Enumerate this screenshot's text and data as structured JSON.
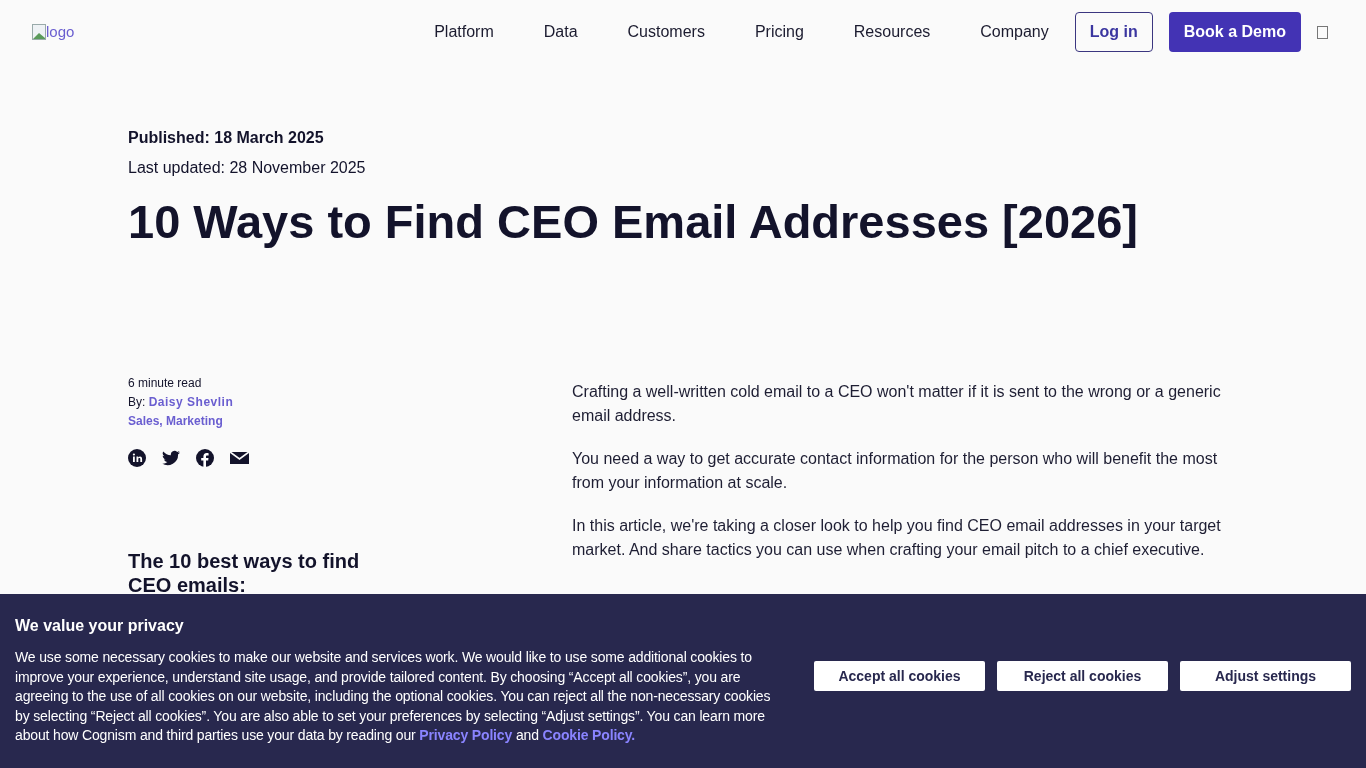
{
  "header": {
    "logo_alt": "logo",
    "nav": [
      "Platform",
      "Data",
      "Customers",
      "Pricing",
      "Resources",
      "Company"
    ],
    "login": "Log in",
    "demo": "Book a Demo"
  },
  "article": {
    "published": "Published: 18 March 2025",
    "updated": "Last updated: 28 November 2025",
    "title": "10 Ways to Find CEO Email Addresses [2026]",
    "read_time": "6 minute read",
    "by": "By:",
    "author": "Daisy Shevlin",
    "tags": "Sales, Marketing",
    "share": [
      {
        "kind": "linkedin"
      },
      {
        "kind": "twitter"
      },
      {
        "kind": "facebook"
      },
      {
        "kind": "email"
      }
    ],
    "toc_title": "The 10 best ways to find CEO emails:",
    "paragraphs": [
      "Crafting a well-written cold email to a CEO won't matter if it is sent to the wrong or a generic email address.",
      "You need a way to get accurate contact information for the person who will benefit the most from your information at scale.",
      "In this article, we're taking a closer look to help you find CEO email addresses in your target market. And share tactics you can use when crafting your email pitch to a chief executive."
    ]
  },
  "cookie_banner": {
    "title": "We value your privacy",
    "body": [
      {
        "kind": "text",
        "text": "We use some necessary cookies to make our website and services work. We would like to use some additional cookies to improve your experience, understand site usage, and provide tailored content. By choosing “Accept all cookies”, you are agreeing to the use of all cookies on our website, including the optional cookies. You can reject all the non-necessary cookies by selecting “Reject all cookies”. You are also able to set your preferences by selecting “Adjust settings”. You can learn more about how Cognism and third parties use your data by reading our "
      },
      {
        "kind": "link",
        "text": "Privacy Policy"
      },
      {
        "kind": "text",
        "text": " and "
      },
      {
        "kind": "link",
        "text": "Cookie Policy."
      }
    ],
    "buttons": [
      "Accept all cookies",
      "Reject all cookies",
      "Adjust settings"
    ]
  }
}
